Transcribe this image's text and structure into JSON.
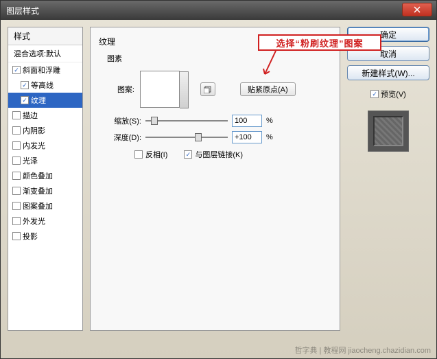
{
  "window": {
    "title": "图层样式"
  },
  "styles_panel": {
    "header": "样式",
    "blend": "混合选项:默认",
    "items": [
      {
        "label": "斜面和浮雕",
        "checked": true,
        "selected": false,
        "indent": false
      },
      {
        "label": "等高线",
        "checked": true,
        "selected": false,
        "indent": true
      },
      {
        "label": "纹理",
        "checked": true,
        "selected": true,
        "indent": true
      },
      {
        "label": "描边",
        "checked": false,
        "selected": false,
        "indent": false
      },
      {
        "label": "内阴影",
        "checked": false,
        "selected": false,
        "indent": false
      },
      {
        "label": "内发光",
        "checked": false,
        "selected": false,
        "indent": false
      },
      {
        "label": "光泽",
        "checked": false,
        "selected": false,
        "indent": false
      },
      {
        "label": "颜色叠加",
        "checked": false,
        "selected": false,
        "indent": false
      },
      {
        "label": "渐变叠加",
        "checked": false,
        "selected": false,
        "indent": false
      },
      {
        "label": "图案叠加",
        "checked": false,
        "selected": false,
        "indent": false
      },
      {
        "label": "外发光",
        "checked": false,
        "selected": false,
        "indent": false
      },
      {
        "label": "投影",
        "checked": false,
        "selected": false,
        "indent": false
      }
    ]
  },
  "main": {
    "group_title": "纹理",
    "pattern_section": "图素",
    "pattern_label": "图案:",
    "snap_origin": "贴紧原点(A)",
    "scale_label": "缩放(S):",
    "scale_value": "100",
    "depth_label": "深度(D):",
    "depth_value": "+100",
    "percent": "%",
    "invert": "反相(I)",
    "link_layer": "与图层链接(K)",
    "callout": "选择“粉刷纹理”图案"
  },
  "buttons": {
    "ok": "确定",
    "cancel": "取消",
    "new_style": "新建样式(W)...",
    "preview": "预览(V)"
  },
  "watermark": "哲字典 | 教程网  jiaocheng.chazidian.com"
}
